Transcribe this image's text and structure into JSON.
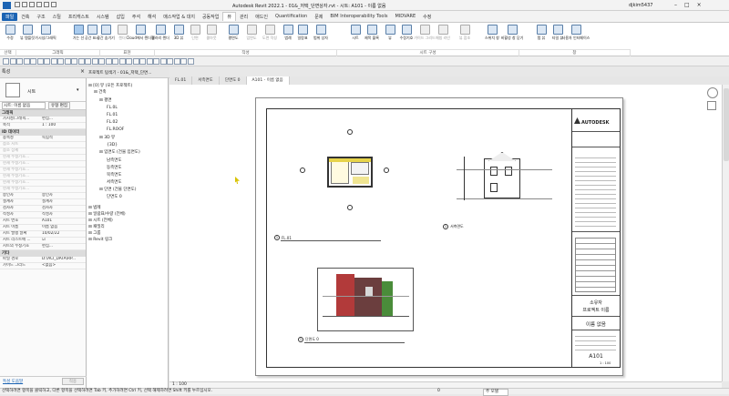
{
  "window": {
    "title": "Autodesk Revit 2022.1 - 01&_저택_단면상자.rvt - 시트: A101 - 이름 없음",
    "user": "djkim5437"
  },
  "menu": [
    "파일",
    "건축",
    "구조",
    "스틸",
    "프리캐스트",
    "시스템",
    "삽입",
    "주석",
    "해석",
    "매스작업 & 대지",
    "공동작업",
    "뷰",
    "관리",
    "애드인",
    "Quantification",
    "문제",
    "BIM Interoperability Tools",
    "MIDVARE",
    "수정"
  ],
  "ribbon": {
    "buttons": [
      "수정",
      "뷰 템플릿",
      "가시성/그래픽",
      "가는 선",
      "공간 표시",
      "공간 숨기기",
      "렌더",
      "Cloud에서 렌더링",
      "갤러리 렌더",
      "3D 뷰",
      "단면",
      "콜아웃",
      "평면도",
      "입면도",
      "도면 작성",
      "범례",
      "일람표",
      "범위 상자",
      "시트",
      "제목 블록",
      "뷰",
      "수정기호",
      "가이드 그리드",
      "매칭 라인",
      "뷰 참조",
      "스위치 창",
      "비활성 창 닫기",
      "탭 뷰",
      "타일 뷰",
      "사용자 인터페이스"
    ],
    "panels": [
      "선택",
      "그래픽",
      "표현",
      "작성",
      "시트 구성",
      "창"
    ]
  },
  "properties": {
    "header": "특성",
    "type": "시트",
    "filter": "시트: 이름 없음",
    "edit_type": "유형 편집",
    "sections": [
      {
        "title": "그래픽",
        "rows": [
          [
            "가시성/그래픽...",
            "편집..."
          ],
          [
            "축척",
            "1 : 100"
          ]
        ]
      },
      {
        "title": "ID 데이터",
        "rows": [
          [
            "종속성",
            "독립적"
          ],
          [
            "참조 시트",
            ""
          ],
          [
            "참조 상세",
            ""
          ],
          [
            "현재 수정기호...",
            ""
          ],
          [
            "현재 수정기호...",
            ""
          ],
          [
            "현재 수정기호...",
            ""
          ],
          [
            "현재 수정기호...",
            ""
          ],
          [
            "현재 수정기호...",
            ""
          ],
          [
            "현재 수정기호...",
            ""
          ],
          [
            "승인자",
            "승인자"
          ],
          [
            "설계자",
            "설계자"
          ],
          [
            "검사자",
            "검사자"
          ],
          [
            "작성자",
            "작성자"
          ],
          [
            "시트 번호",
            "A101"
          ],
          [
            "시트 이름",
            "이름 없음"
          ],
          [
            "시트 발행 날짜",
            "10/02/22"
          ],
          [
            "시트 리스트에 ...",
            "☑"
          ],
          [
            "시트의 수정기호",
            "편집..."
          ]
        ]
      },
      {
        "title": "기타",
        "rows": [
          [
            "파일 경로",
            "D:\\ACI_DATA\\RP..."
          ],
          [
            "가이드 그리드",
            "<없음>"
          ]
        ]
      }
    ],
    "help": "특성 도움말",
    "apply": "적용"
  },
  "browser": {
    "title": "프로젝트 탐색기 - 01&_저택_단면...",
    "nodes": [
      "[0] 뷰 (모든 프로젝트)",
      "건축",
      "평면",
      "FL.0L",
      "FL.01",
      "FL.02",
      "FL.ROOF",
      "3D 뷰",
      "{3D}",
      "입면도 (건물 입면도)",
      "남측면도",
      "동측면도",
      "북측면도",
      "서측면도",
      "단면 (건물 단면도)",
      "단면도 0",
      "범례",
      "일람표/수량 (전체)",
      "시트 (전체)",
      "패밀리",
      "그룹",
      "Revit 링크"
    ]
  },
  "tabs": [
    "FL.01",
    "서측면도",
    "단면도 0",
    "A101 - 이름 없음"
  ],
  "titleblock": {
    "logo": "AUTODESK",
    "owner": "소유자",
    "project": "프로젝트 이름",
    "sheet_name": "이름 없음",
    "sheet_number": "A101",
    "scale": "1 : 100"
  },
  "views": {
    "plan": "FL.01",
    "section": "단면도 0",
    "elevation": "서측면도"
  },
  "status": {
    "hint": "선택하려면 항목을 클릭하고, 다른 항목을 선택하려면 Tab 키, 추가하려면 Ctrl 키, 선택 해제하려면 Shift 키를 누르십시오.",
    "model": "주 모델",
    "scale_val": "0"
  }
}
